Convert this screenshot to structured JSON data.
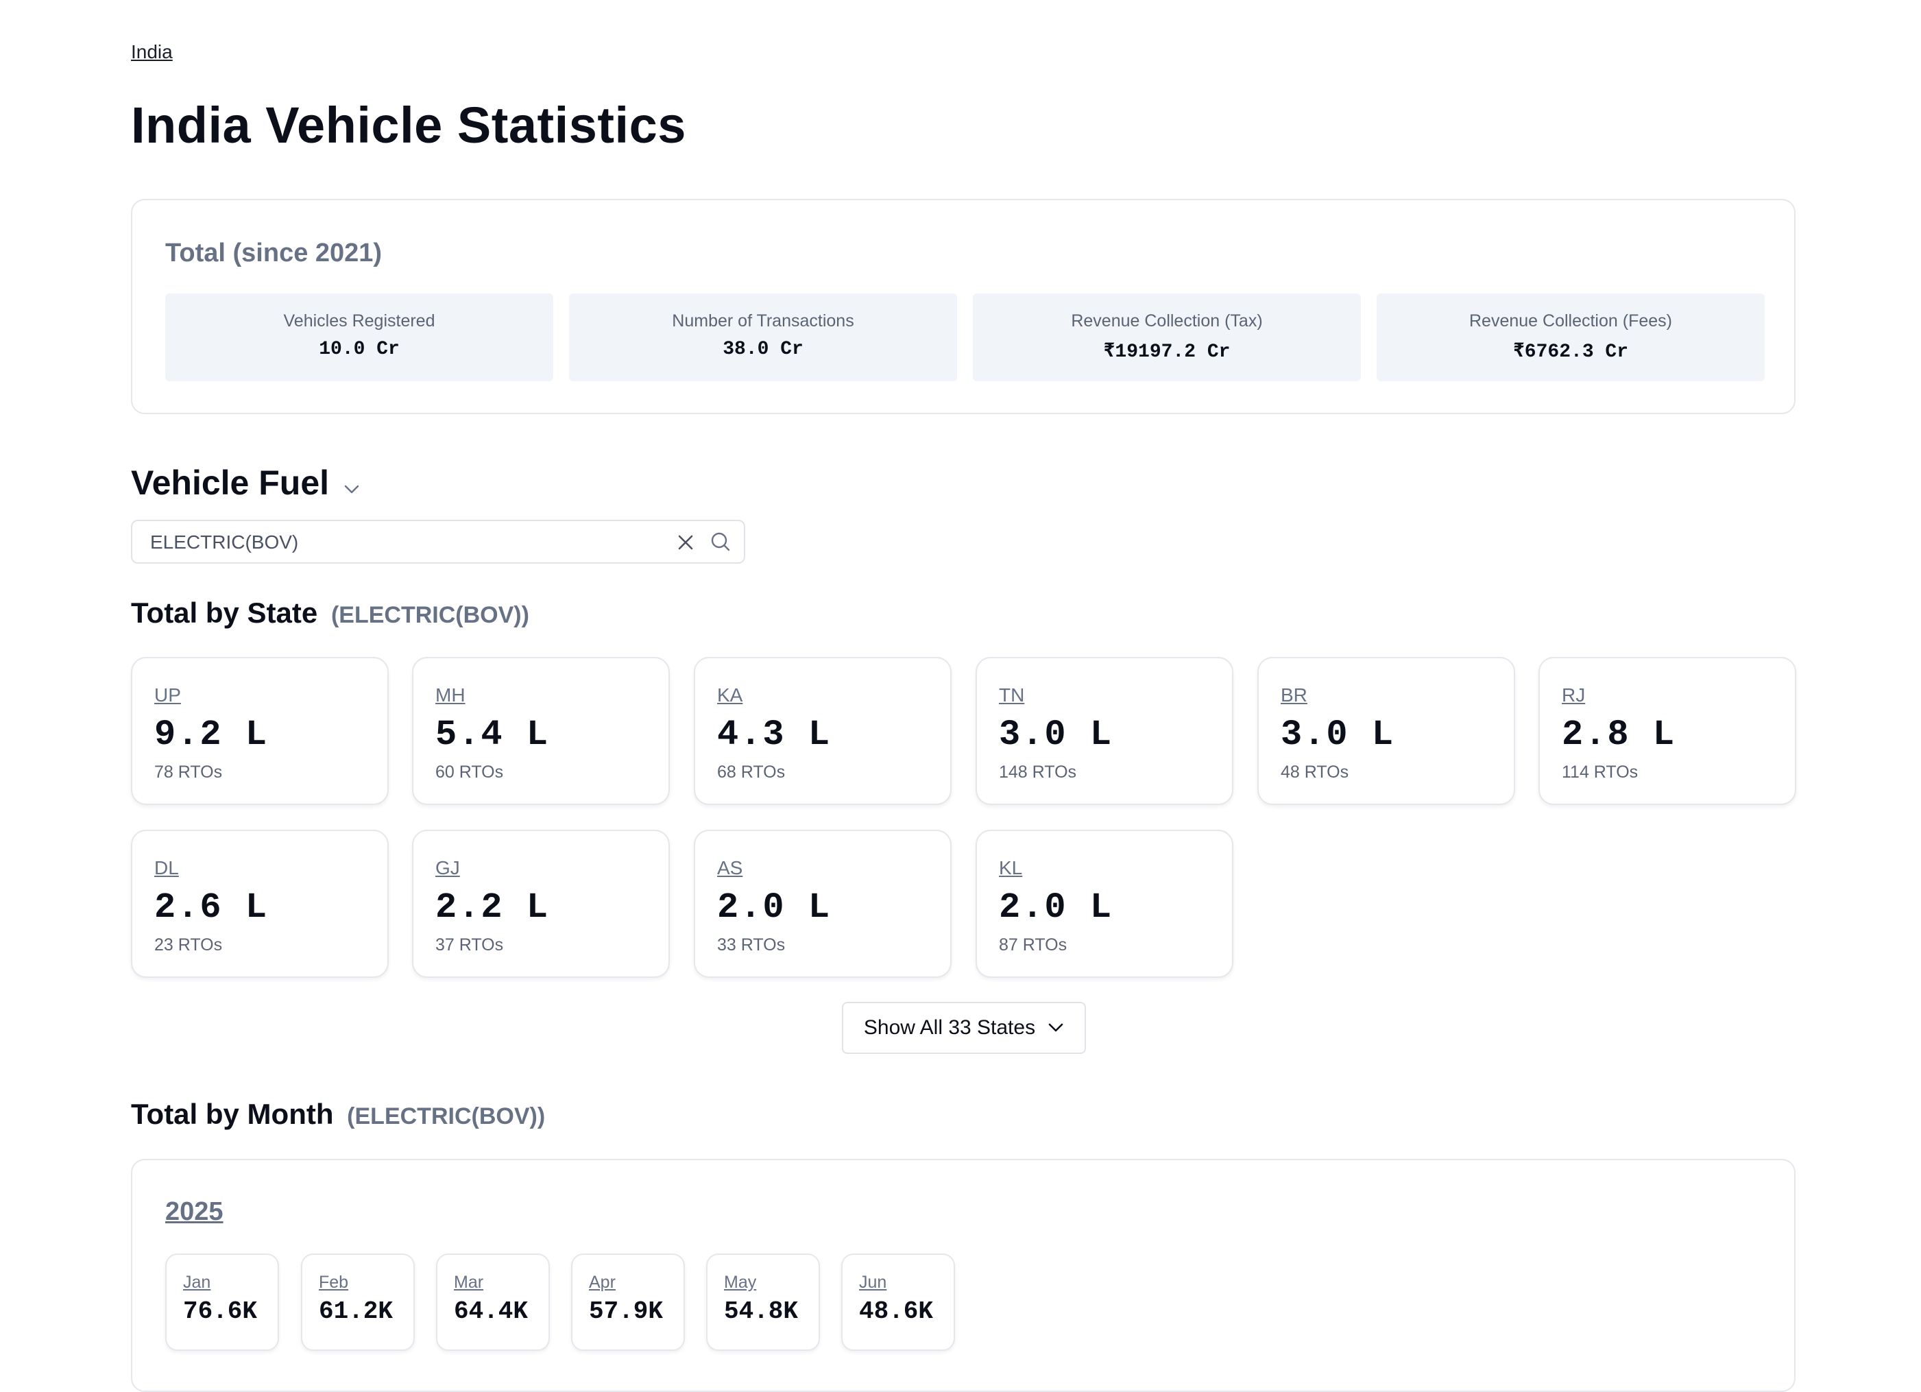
{
  "breadcrumb": "India",
  "page_title": "India Vehicle Statistics",
  "totals": {
    "title": "Total (since 2021)",
    "stats": [
      {
        "label": "Vehicles Registered",
        "value": "10.0 Cr"
      },
      {
        "label": "Number of Transactions",
        "value": "38.0 Cr"
      },
      {
        "label": "Revenue Collection (Tax)",
        "value": "₹19197.2 Cr"
      },
      {
        "label": "Revenue Collection (Fees)",
        "value": "₹6762.3 Cr"
      }
    ]
  },
  "fuel": {
    "heading": "Vehicle Fuel",
    "search_value": "ELECTRIC(BOV)",
    "icons": {
      "dropdown": "chevron-down-icon",
      "clear": "close-icon",
      "search": "search-icon"
    }
  },
  "by_state": {
    "title": "Total by State",
    "subtitle": "(ELECTRIC(BOV))",
    "states": [
      {
        "code": "UP",
        "value": "9.2 L",
        "rtos": "78 RTOs"
      },
      {
        "code": "MH",
        "value": "5.4 L",
        "rtos": "60 RTOs"
      },
      {
        "code": "KA",
        "value": "4.3 L",
        "rtos": "68 RTOs"
      },
      {
        "code": "TN",
        "value": "3.0 L",
        "rtos": "148 RTOs"
      },
      {
        "code": "BR",
        "value": "3.0 L",
        "rtos": "48 RTOs"
      },
      {
        "code": "RJ",
        "value": "2.8 L",
        "rtos": "114 RTOs"
      },
      {
        "code": "DL",
        "value": "2.6 L",
        "rtos": "23 RTOs"
      },
      {
        "code": "GJ",
        "value": "2.2 L",
        "rtos": "37 RTOs"
      },
      {
        "code": "AS",
        "value": "2.0 L",
        "rtos": "33 RTOs"
      },
      {
        "code": "KL",
        "value": "2.0 L",
        "rtos": "87 RTOs"
      }
    ],
    "show_all_label": "Show All 33 States"
  },
  "by_month": {
    "title": "Total by Month",
    "subtitle": "(ELECTRIC(BOV))",
    "year": "2025",
    "months": [
      {
        "name": "Jan",
        "value": "76.6K"
      },
      {
        "name": "Feb",
        "value": "61.2K"
      },
      {
        "name": "Mar",
        "value": "64.4K"
      },
      {
        "name": "Apr",
        "value": "57.9K"
      },
      {
        "name": "May",
        "value": "54.8K"
      },
      {
        "name": "Jun",
        "value": "48.6K"
      }
    ]
  },
  "colors": {
    "text": "#0b0f1a",
    "muted": "#677185",
    "stat_bg": "#f1f4f8",
    "border": "#e4e7ec"
  }
}
